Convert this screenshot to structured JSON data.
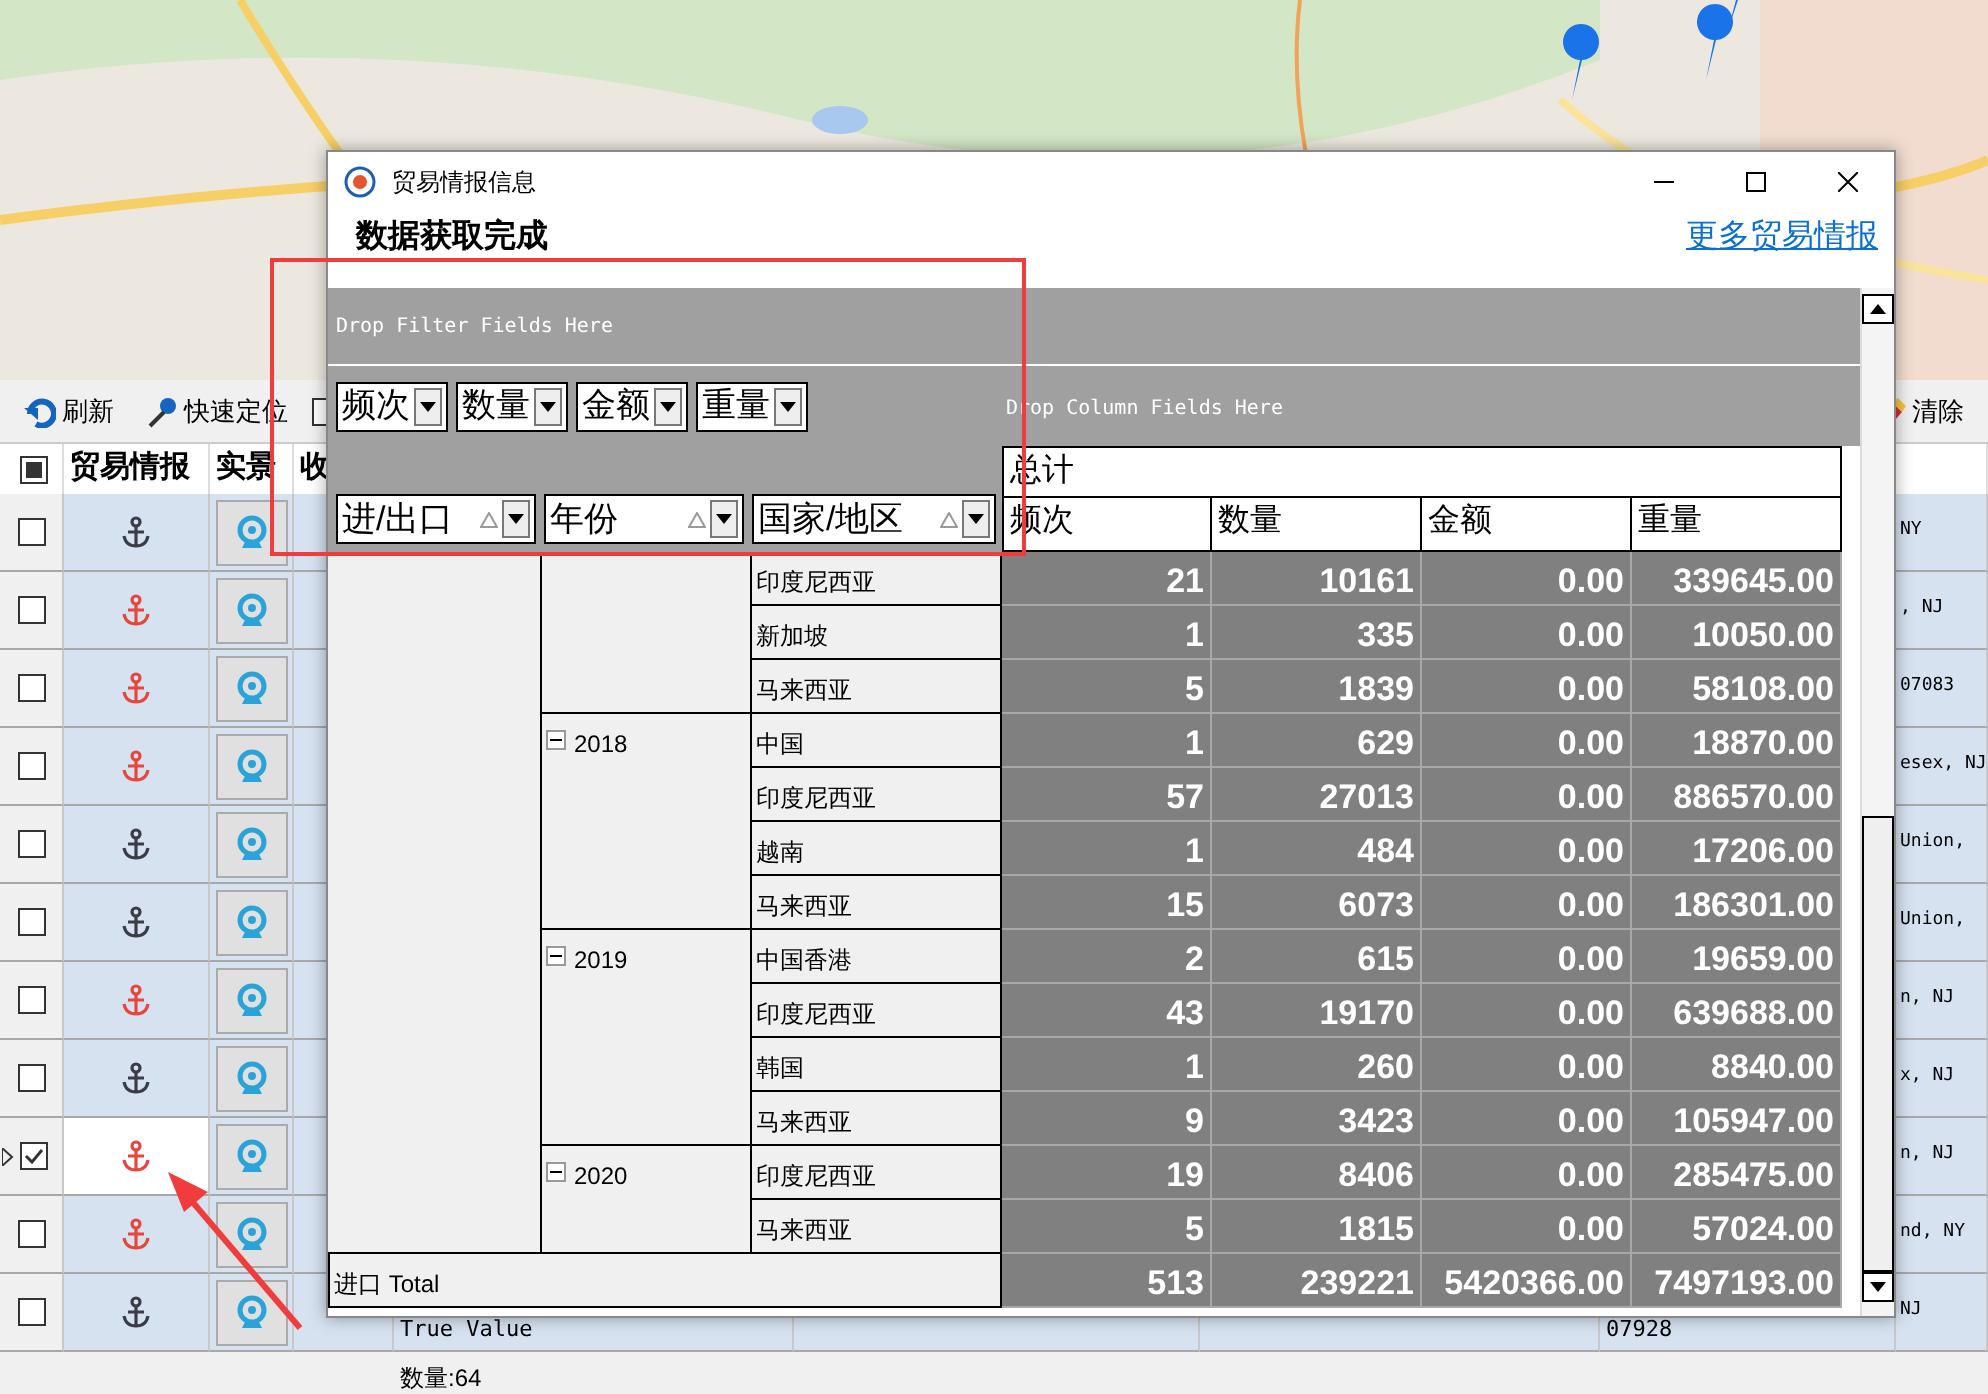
{
  "toolbar": {
    "buttons": [
      {
        "kind": "refresh",
        "label": "刷新"
      },
      {
        "kind": "locate",
        "label": "快速定位"
      }
    ],
    "option": {
      "checked": false
    },
    "clear_button": {
      "label": "清除"
    }
  },
  "grid": {
    "select_all": {
      "checked": true
    },
    "columns": [
      "贸易情报",
      "实景",
      "收"
    ],
    "rows": [
      {
        "color": "#3c3c46",
        "checked": false,
        "selected": false,
        "address": "NY"
      },
      {
        "color": "#e8453c",
        "checked": false,
        "selected": false,
        "address": ", NJ"
      },
      {
        "color": "#e8453c",
        "checked": false,
        "selected": false,
        "address": "07083"
      },
      {
        "color": "#e8453c",
        "checked": false,
        "selected": false,
        "address": "esex, NJ"
      },
      {
        "color": "#3c3c46",
        "checked": false,
        "selected": false,
        "address": "Union,"
      },
      {
        "color": "#3c3c46",
        "checked": false,
        "selected": false,
        "address": "Union,"
      },
      {
        "color": "#e8453c",
        "checked": false,
        "selected": false,
        "address": "n, NJ"
      },
      {
        "color": "#3c3c46",
        "checked": false,
        "selected": false,
        "address": "x, NJ"
      },
      {
        "color": "#e8453c",
        "checked": true,
        "selected": true,
        "address": "n, NJ"
      },
      {
        "color": "#e8453c",
        "checked": false,
        "selected": false,
        "address": "nd, NY"
      },
      {
        "color": "#3c3c46",
        "checked": false,
        "selected": false,
        "address": "NJ",
        "name": "True Value",
        "zip": "07928"
      }
    ],
    "status": "数量:64"
  },
  "dialog": {
    "title": "贸易情报信息",
    "message": "数据获取完成",
    "link": "更多贸易情报",
    "pivot": {
      "filter_hint": "Drop Filter Fields Here",
      "column_hint": "Drop Column Fields Here",
      "data_fields": [
        "频次",
        "数量",
        "金额",
        "重量"
      ],
      "row_fields": [
        "进/出口",
        "年份",
        "国家/地区"
      ],
      "column_total": "总计",
      "columns": [
        "频次",
        "数量",
        "金额",
        "重量"
      ],
      "groups": [
        {
          "rows": [
            {
              "country": "印度尼西亚",
              "values": [
                "21",
                "10161",
                "0.00",
                "339645.00"
              ]
            },
            {
              "country": "新加坡",
              "values": [
                "1",
                "335",
                "0.00",
                "10050.00"
              ]
            },
            {
              "country": "马来西亚",
              "values": [
                "5",
                "1839",
                "0.00",
                "58108.00"
              ]
            }
          ]
        },
        {
          "year": "2018",
          "expanded": true,
          "rows": [
            {
              "country": "中国",
              "values": [
                "1",
                "629",
                "0.00",
                "18870.00"
              ]
            },
            {
              "country": "印度尼西亚",
              "values": [
                "57",
                "27013",
                "0.00",
                "886570.00"
              ]
            },
            {
              "country": "越南",
              "values": [
                "1",
                "484",
                "0.00",
                "17206.00"
              ]
            },
            {
              "country": "马来西亚",
              "values": [
                "15",
                "6073",
                "0.00",
                "186301.00"
              ]
            }
          ]
        },
        {
          "year": "2019",
          "expanded": true,
          "rows": [
            {
              "country": "中国香港",
              "values": [
                "2",
                "615",
                "0.00",
                "19659.00"
              ]
            },
            {
              "country": "印度尼西亚",
              "values": [
                "43",
                "19170",
                "0.00",
                "639688.00"
              ]
            },
            {
              "country": "韩国",
              "values": [
                "1",
                "260",
                "0.00",
                "8840.00"
              ]
            },
            {
              "country": "马来西亚",
              "values": [
                "9",
                "3423",
                "0.00",
                "105947.00"
              ]
            }
          ]
        },
        {
          "year": "2020",
          "expanded": true,
          "rows": [
            {
              "country": "印度尼西亚",
              "values": [
                "19",
                "8406",
                "0.00",
                "285475.00"
              ]
            },
            {
              "country": "马来西亚",
              "values": [
                "5",
                "1815",
                "0.00",
                "57024.00"
              ]
            }
          ]
        }
      ],
      "total": {
        "label": "进口 Total",
        "values": [
          "513",
          "239221",
          "5420366.00",
          "7497193.00"
        ]
      }
    }
  }
}
